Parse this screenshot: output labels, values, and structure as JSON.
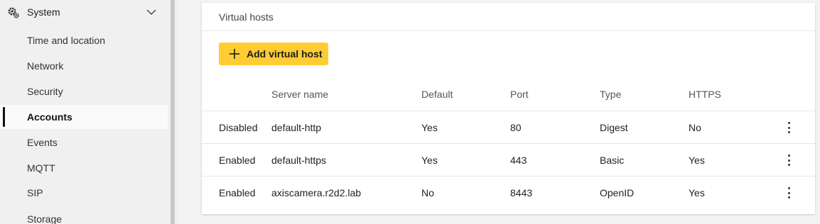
{
  "sidebar": {
    "section": {
      "label": "System",
      "icon": "gear-icon",
      "expanded": true
    },
    "items": [
      {
        "label": "Time and location",
        "active": false
      },
      {
        "label": "Network",
        "active": false
      },
      {
        "label": "Security",
        "active": false
      },
      {
        "label": "Accounts",
        "active": true
      },
      {
        "label": "Events",
        "active": false
      },
      {
        "label": "MQTT",
        "active": false
      },
      {
        "label": "SIP",
        "active": false
      },
      {
        "label": "Storage",
        "active": false
      }
    ]
  },
  "card": {
    "title": "Virtual hosts",
    "add_button": {
      "label": "Add virtual host",
      "color": "#ffcc33"
    },
    "table": {
      "columns": [
        "",
        "Server name",
        "Default",
        "Port",
        "Type",
        "HTTPS"
      ],
      "rows": [
        [
          "Disabled",
          "default-http",
          "Yes",
          "80",
          "Digest",
          "No"
        ],
        [
          "Enabled",
          "default-https",
          "Yes",
          "443",
          "Basic",
          "Yes"
        ],
        [
          "Enabled",
          "axiscamera.r2d2.lab",
          "No",
          "8443",
          "OpenID",
          "Yes"
        ]
      ]
    }
  }
}
